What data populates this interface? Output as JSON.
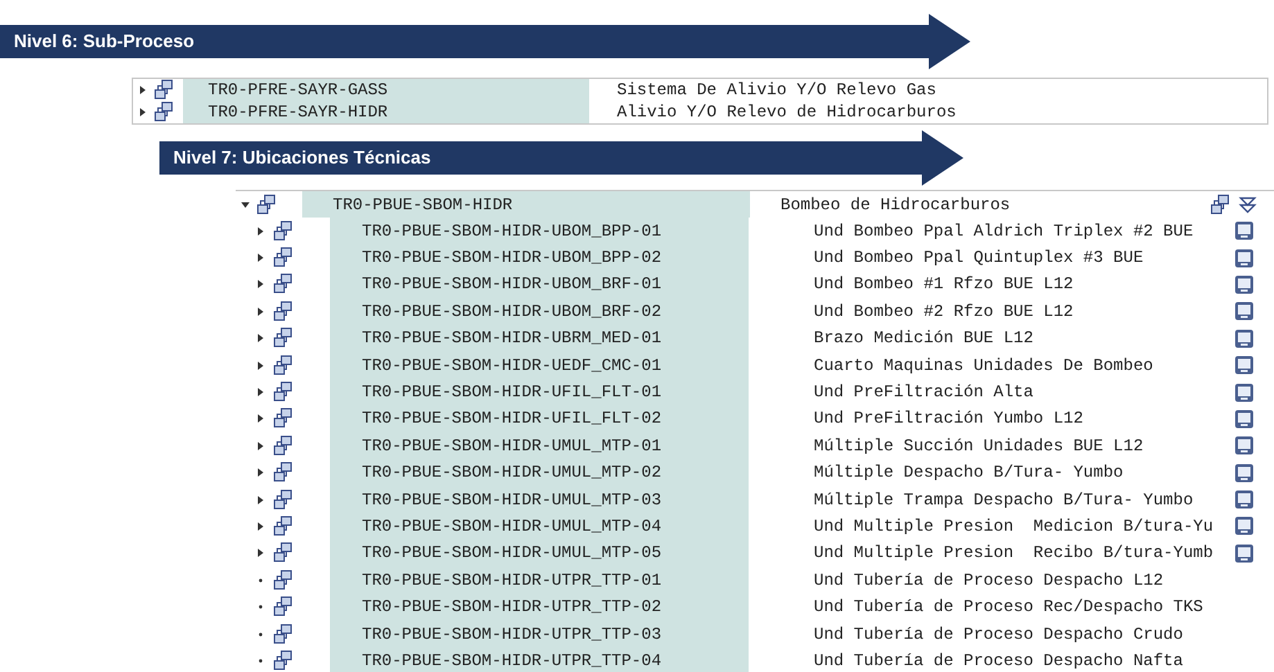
{
  "banners": [
    {
      "label": "Nivel 6: Sub-Proceso"
    },
    {
      "label": "Nivel 7: Ubicaciones Técnicas"
    }
  ],
  "subprocess_tree": {
    "rows": [
      {
        "kind": "collapsed",
        "id": "TR0-PFRE-SAYR-GASS",
        "description": "Sistema De Alivio Y/O Relevo Gas"
      },
      {
        "kind": "collapsed",
        "id": "TR0-PFRE-SAYR-HIDR",
        "description": "Alivio Y/O Relevo de Hidrocarburos"
      }
    ]
  },
  "location_tree": {
    "root": {
      "kind": "expanded",
      "id": "TR0-PBUE-SBOM-HIDR",
      "description": "Bombeo de Hidrocarburos"
    },
    "rows": [
      {
        "kind": "collapsed",
        "id": "TR0-PBUE-SBOM-HIDR-UBOM_BPP-01",
        "description": "Und Bombeo Ppal Aldrich Triplex #2 BUE",
        "detail_icon": true
      },
      {
        "kind": "collapsed",
        "id": "TR0-PBUE-SBOM-HIDR-UBOM_BPP-02",
        "description": "Und Bombeo Ppal Quintuplex #3 BUE",
        "detail_icon": true
      },
      {
        "kind": "collapsed",
        "id": "TR0-PBUE-SBOM-HIDR-UBOM_BRF-01",
        "description": "Und Bombeo #1 Rfzo BUE L12",
        "detail_icon": true
      },
      {
        "kind": "collapsed",
        "id": "TR0-PBUE-SBOM-HIDR-UBOM_BRF-02",
        "description": "Und Bombeo #2 Rfzo BUE L12",
        "detail_icon": true
      },
      {
        "kind": "collapsed",
        "id": "TR0-PBUE-SBOM-HIDR-UBRM_MED-01",
        "description": "Brazo Medición BUE L12",
        "detail_icon": true
      },
      {
        "kind": "collapsed",
        "id": "TR0-PBUE-SBOM-HIDR-UEDF_CMC-01",
        "description": "Cuarto Maquinas Unidades De Bombeo",
        "detail_icon": true
      },
      {
        "kind": "collapsed",
        "id": "TR0-PBUE-SBOM-HIDR-UFIL_FLT-01",
        "description": "Und PreFiltración Alta",
        "detail_icon": true
      },
      {
        "kind": "collapsed",
        "id": "TR0-PBUE-SBOM-HIDR-UFIL_FLT-02",
        "description": "Und PreFiltración Yumbo L12",
        "detail_icon": true
      },
      {
        "kind": "collapsed",
        "id": "TR0-PBUE-SBOM-HIDR-UMUL_MTP-01",
        "description": "Múltiple Succión Unidades BUE L12",
        "detail_icon": true
      },
      {
        "kind": "collapsed",
        "id": "TR0-PBUE-SBOM-HIDR-UMUL_MTP-02",
        "description": "Múltiple Despacho B/Tura- Yumbo",
        "detail_icon": true
      },
      {
        "kind": "collapsed",
        "id": "TR0-PBUE-SBOM-HIDR-UMUL_MTP-03",
        "description": "Múltiple Trampa Despacho B/Tura- Yumbo",
        "detail_icon": true
      },
      {
        "kind": "collapsed",
        "id": "TR0-PBUE-SBOM-HIDR-UMUL_MTP-04",
        "description": "Und Multiple Presion  Medicion B/tura-Yu",
        "detail_icon": true
      },
      {
        "kind": "collapsed",
        "id": "TR0-PBUE-SBOM-HIDR-UMUL_MTP-05",
        "description": "Und Multiple Presion  Recibo B/tura-Yumb",
        "detail_icon": true
      },
      {
        "kind": "leaf",
        "id": "TR0-PBUE-SBOM-HIDR-UTPR_TTP-01",
        "description": "Und Tubería de Proceso Despacho L12",
        "detail_icon": false
      },
      {
        "kind": "leaf",
        "id": "TR0-PBUE-SBOM-HIDR-UTPR_TTP-02",
        "description": "Und Tubería de Proceso Rec/Despacho TKS",
        "detail_icon": false
      },
      {
        "kind": "leaf",
        "id": "TR0-PBUE-SBOM-HIDR-UTPR_TTP-03",
        "description": "Und Tubería de Proceso Despacho Crudo",
        "detail_icon": false
      },
      {
        "kind": "leaf",
        "id": "TR0-PBUE-SBOM-HIDR-UTPR_TTP-04",
        "description": "Und Tubería de Proceso Despacho Nafta",
        "detail_icon": false
      }
    ]
  }
}
